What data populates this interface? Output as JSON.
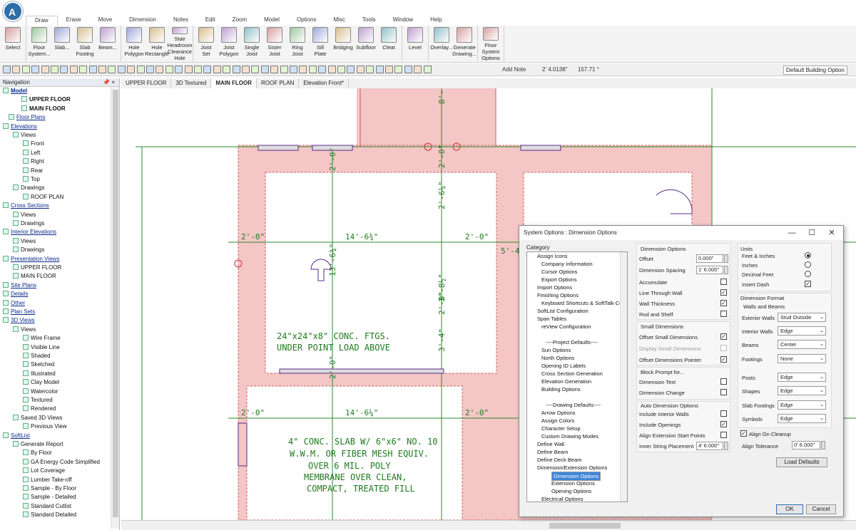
{
  "menu": {
    "tabs": [
      "Draw",
      "Erase",
      "Move",
      "Dimension",
      "Notes",
      "Edit",
      "Zoom",
      "Model",
      "Options",
      "Misc",
      "Tools",
      "Window",
      "Help"
    ]
  },
  "ribbon": {
    "groups": [
      [
        {
          "label": "Select"
        }
      ],
      [
        {
          "label": "Floor\nSystem..."
        },
        {
          "label": "Slab..."
        },
        {
          "label": "Slab\nFooting"
        },
        {
          "label": "Beam..."
        }
      ],
      [
        {
          "label": "Hole\nPolygon"
        },
        {
          "label": "Hole\nRectangle"
        },
        {
          "label": "Stair Headroom\nClearance Hole"
        }
      ],
      [
        {
          "label": "Joist\nSet"
        },
        {
          "label": "Joist\nPolygon"
        },
        {
          "label": "Single\nJoist"
        },
        {
          "label": "Sister\nJoist"
        },
        {
          "label": "Ring\nJoist"
        },
        {
          "label": "Sill\nPlate"
        },
        {
          "label": "Bridging"
        },
        {
          "label": "Subfloor"
        },
        {
          "label": "Cleat"
        }
      ],
      [
        {
          "label": "Level"
        }
      ],
      [
        {
          "label": "Overlay..."
        },
        {
          "label": "Generate\nDrawing..."
        }
      ],
      [
        {
          "label": "Floor System\nOptions"
        }
      ]
    ]
  },
  "toolbar": {
    "add_note": "Add Note",
    "coord": "2' 4.0138\"",
    "angle": "157.71 °",
    "default_option": "Default Building Option"
  },
  "navigation": {
    "title": "Navigation",
    "pin": "📌 ×",
    "items": [
      {
        "label": "Model",
        "style": "bold link"
      },
      {
        "label": "UPPER FLOOR",
        "style": "bold"
      },
      {
        "label": "MAIN FLOOR",
        "style": "bold"
      },
      {
        "label": "Floor Plans",
        "style": "link"
      },
      {
        "label": "Elevations",
        "style": "link"
      },
      {
        "label": "Views",
        "style": ""
      },
      {
        "label": "Front",
        "style": ""
      },
      {
        "label": "Left",
        "style": ""
      },
      {
        "label": "Right",
        "style": ""
      },
      {
        "label": "Rear",
        "style": ""
      },
      {
        "label": "Top",
        "style": ""
      },
      {
        "label": "Drawings",
        "style": ""
      },
      {
        "label": "ROOF PLAN",
        "style": ""
      },
      {
        "label": "Cross Sections",
        "style": "link"
      },
      {
        "label": "Views",
        "style": ""
      },
      {
        "label": "Drawings",
        "style": ""
      },
      {
        "label": "Interior Elevations",
        "style": "link"
      },
      {
        "label": "Views",
        "style": ""
      },
      {
        "label": "Drawings",
        "style": ""
      },
      {
        "label": "Presentation Views",
        "style": "link"
      },
      {
        "label": "UPPER FLOOR",
        "style": ""
      },
      {
        "label": "MAIN FLOOR",
        "style": ""
      },
      {
        "label": "Site Plans",
        "style": "link"
      },
      {
        "label": "Details",
        "style": "link"
      },
      {
        "label": "Other",
        "style": "link"
      },
      {
        "label": "Plan Sets",
        "style": "link"
      },
      {
        "label": "3D Views",
        "style": "link"
      },
      {
        "label": "Views",
        "style": ""
      },
      {
        "label": "Wire Frame",
        "style": ""
      },
      {
        "label": "Visible Line",
        "style": ""
      },
      {
        "label": "Shaded",
        "style": ""
      },
      {
        "label": "Sketched",
        "style": ""
      },
      {
        "label": "Illustrated",
        "style": ""
      },
      {
        "label": "Clay Model",
        "style": ""
      },
      {
        "label": "Watercolor",
        "style": ""
      },
      {
        "label": "Textured",
        "style": ""
      },
      {
        "label": "Rendered",
        "style": ""
      },
      {
        "label": "Saved 3D Views",
        "style": ""
      },
      {
        "label": "Previous View",
        "style": ""
      },
      {
        "label": "SoftList",
        "style": "link"
      },
      {
        "label": "Generate Report",
        "style": ""
      },
      {
        "label": "By Floor",
        "style": ""
      },
      {
        "label": "GA Energy Code Simplified",
        "style": ""
      },
      {
        "label": "Lot Coverage",
        "style": ""
      },
      {
        "label": "Lumber Take-off",
        "style": ""
      },
      {
        "label": "Sample - By Floor",
        "style": ""
      },
      {
        "label": "Sample - Detailed",
        "style": ""
      },
      {
        "label": "Standard Cutlist",
        "style": ""
      },
      {
        "label": "Standard Detailed",
        "style": ""
      }
    ]
  },
  "doc_tabs": [
    "UPPER FLOOR",
    "3D Textured",
    "MAIN FLOOR",
    "ROOF PLAN",
    "Elevation Front*"
  ],
  "drawing": {
    "notes": [
      "24\"x24\"x8\" CONC. FTGS.",
      "UNDER POINT LOAD ABOVE",
      "4\" CONC. SLAB W/ 6\"x6\" NO. 10",
      "W.W.M. OR FIBER MESH EQUIV.",
      "OVER 6 MIL. POLY",
      "MEMBRANE OVER CLEAN,",
      "COMPACT, TREATED FILL"
    ],
    "dims": [
      "14'-6¾\"",
      "14'-6¼\"",
      "2'-0\"",
      "2'-0\"",
      "2'-0\"",
      "2'-0\"",
      "13'-6¾\"",
      "3'-8½\"",
      "2'-0\"",
      "2'-6¼\"",
      "3'-4\"",
      "2'-0\"",
      "2'-0\"",
      "2'-0\"",
      "5'-4\"",
      "8'-"
    ]
  },
  "dialog": {
    "title": "System Options : Dimension Options",
    "category_label": "Category",
    "categories": [
      "Assign Icons",
      "Company Information",
      "Cursor Options",
      "Export Options",
      "Import Options",
      "Finishing Options",
      "Keyboard Shortcuts & SoftTalk Com",
      "SoftList Configuration",
      "Span Tables",
      "reView Configuration",
      "",
      "----Project Defaults----",
      "Sun Options",
      "North Options",
      "Opening ID Labels",
      "Cross Section Generation",
      "Elevation Generation",
      "Building Options",
      "",
      "----Drawing Defaults----",
      "Arrow Options",
      "Assign Colors",
      "Character Setup",
      "Custom Drawing Modes",
      "Define Wall",
      "Define Beam",
      "Define Deck Beam",
      "Dimension/Extension Options",
      "Dimension Options",
      "Extension Options",
      "Opening Options",
      "Electrical Options"
    ],
    "selected_category": "Dimension Options",
    "dimension_options": {
      "group": "Dimension Options",
      "offset_label": "Offset",
      "offset_value": "0.000\"",
      "spacing_label": "Dimension Spacing",
      "spacing_value": "1' 6.000\"",
      "accumulate": "Accumulate",
      "line_through_wall": "Line Through Wall",
      "wall_thickness": "Wall Thickness",
      "rod_and_shelf": "Rod and Shelf"
    },
    "small_dimensions": {
      "group": "Small Dimensions",
      "offset_small": "Offset Small Dimensions",
      "display_small": "Display Small Dimensions",
      "offset_pointer": "Offset Dimensions Pointer"
    },
    "block_prompt": {
      "group": "Block Prompt for...",
      "dim_text": "Dimension Text",
      "dim_change": "Dimension Change"
    },
    "auto_dimension": {
      "group": "Auto Dimension Options",
      "interior_walls": "Include Interior Walls",
      "openings": "Include Openings",
      "align_ext": "Align Extension Start Points",
      "inner_string_label": "Inner String Placement",
      "inner_string_value": "4' 6.000\""
    },
    "units": {
      "group": "Units",
      "feet_inches": "Feet & Inches",
      "inches": "Inches",
      "decimal_feet": "Decimal Feet",
      "insert_dash": "Insert Dash"
    },
    "dimension_format": {
      "group": "Dimension Format",
      "sub": "Walls and Beams",
      "exterior_walls_label": "Exterior Walls",
      "exterior_walls_value": "Stud Outside",
      "interior_walls_label": "Interior Walls",
      "interior_walls_value": "Edge",
      "beams_label": "Beams",
      "beams_value": "Center",
      "footings_label": "Footings",
      "footings_value": "None",
      "posts_label": "Posts",
      "posts_value": "Edge",
      "shapes_label": "Shapes",
      "shapes_value": "Edge",
      "slab_footings_label": "Slab Footings",
      "slab_footings_value": "Edge",
      "symbols_label": "Symbols",
      "symbols_value": "Edge"
    },
    "align": {
      "cleanup": "Align On Cleanup",
      "tolerance_label": "Align Tolerance",
      "tolerance_value": "0' 6.000\""
    },
    "buttons": {
      "load_defaults": "Load Defaults",
      "ok": "OK",
      "cancel": "Cancel"
    },
    "window_buttons": {
      "min": "—",
      "max": "☐",
      "close": "✕"
    }
  },
  "colors": {
    "slab": "#f4c6c6",
    "slab_edge": "#e07a7a",
    "dim_line": "#2a8a2a",
    "note_text": "#1f7a1f",
    "accent": "#2d6ea8"
  }
}
